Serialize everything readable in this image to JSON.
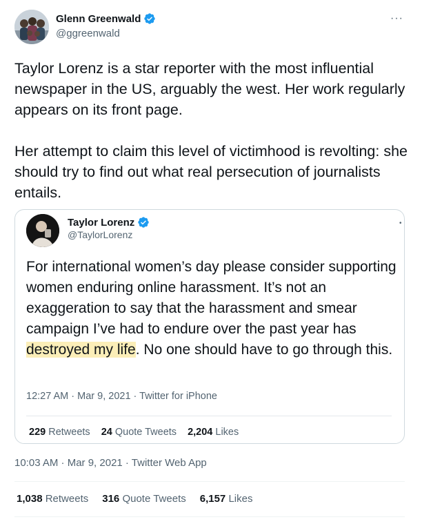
{
  "author": {
    "name": "Glenn Greenwald",
    "handle": "@ggreenwald",
    "verified_icon": "verified-badge-icon"
  },
  "more_label": "···",
  "tweet_text": "Taylor Lorenz is a star reporter with the most influential newspaper in the US, arguably the west. Her work regularly appears on its front page.\n\nHer attempt to claim this level of victimhood is revolting: she should try to find out what real persecution of journalists entails.",
  "quoted": {
    "name": "Taylor Lorenz",
    "handle": "@TaylorLorenz",
    "text_before": "For international women’s day please consider supporting women enduring online harassment. It’s not an exaggeration to say that the harassment and smear campaign I’ve had to endure over the past year has ",
    "text_highlight": "destroyed my life",
    "text_after": ". No one should have to go through this.",
    "meta": "12:27 AM · Mar 9, 2021 · Twitter for iPhone",
    "stats": {
      "retweets_count": "229",
      "retweets_label": "Retweets",
      "quotes_count": "24",
      "quotes_label": "Quote Tweets",
      "likes_count": "2,204",
      "likes_label": "Likes"
    },
    "highlight_color": "#fbeeb8"
  },
  "meta": "10:03 AM · Mar 9, 2021 · Twitter Web App",
  "stats": {
    "retweets_count": "1,038",
    "retweets_label": "Retweets",
    "quotes_count": "316",
    "quotes_label": "Quote Tweets",
    "likes_count": "6,157",
    "likes_label": "Likes"
  },
  "colors": {
    "verified": "#1d9bf0",
    "secondary_text": "#536471",
    "primary_text": "#0f1419"
  }
}
